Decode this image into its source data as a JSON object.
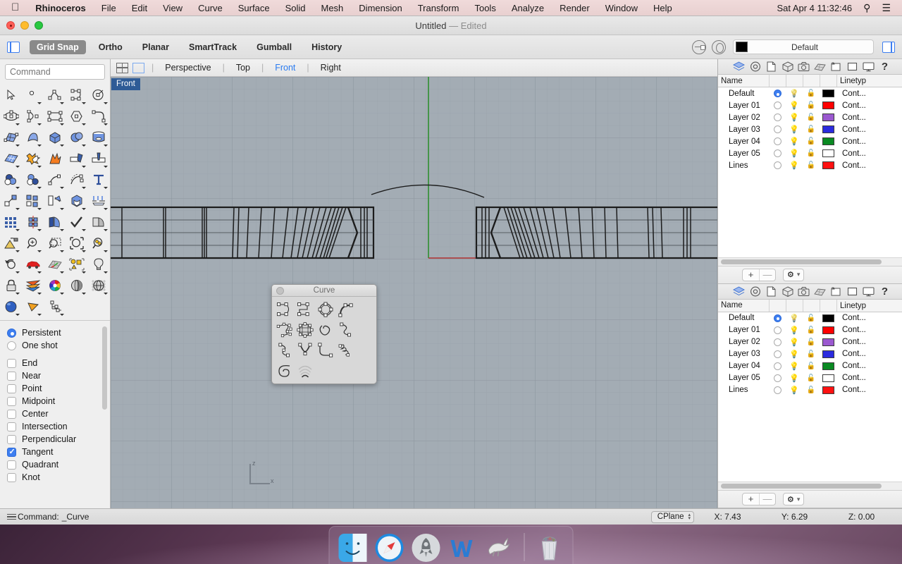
{
  "menubar": {
    "apple_icon": "apple-logo-icon",
    "items": [
      "Rhinoceros",
      "File",
      "Edit",
      "View",
      "Curve",
      "Surface",
      "Solid",
      "Mesh",
      "Dimension",
      "Transform",
      "Tools",
      "Analyze",
      "Render",
      "Window",
      "Help"
    ],
    "clock": "Sat Apr 4  11:32:46",
    "search_icon": "search-icon",
    "notification_icon": "list-icon"
  },
  "window": {
    "title": "Untitled",
    "edited_suffix": "— Edited"
  },
  "toolbar": {
    "toggles": [
      {
        "label": "Grid Snap",
        "active": true
      },
      {
        "label": "Ortho",
        "active": false
      },
      {
        "label": "Planar",
        "active": false
      },
      {
        "label": "SmartTrack",
        "active": false
      },
      {
        "label": "Gumball",
        "active": false
      },
      {
        "label": "History",
        "active": false
      }
    ],
    "layer_swatch_color": "#000000",
    "layer_name": "Default"
  },
  "command": {
    "placeholder": "Command"
  },
  "viewport_tabs": {
    "items": [
      "Perspective",
      "Top",
      "Front",
      "Right"
    ],
    "active": "Front"
  },
  "viewport": {
    "label": "Front",
    "axis_z": "z",
    "axis_x": "x",
    "background_color": "#a3acb4",
    "grid_color": "#8f99a3"
  },
  "curve_palette": {
    "title": "Curve",
    "tools": [
      "control-point-curve-icon",
      "interpolate-curve-icon",
      "curve-through-points-icon",
      "curve-tangent-icon",
      "sketch-curve-icon",
      "curve-network-icon",
      "curve-loop-icon",
      "curve-blend-icon",
      "curve-blend-adjust-icon",
      "parabola-icon",
      "curve-fillet-icon",
      "helix-icon",
      "spiral-icon",
      "arc-array-icon"
    ]
  },
  "osnap": {
    "modes": [
      {
        "label": "Persistent",
        "type": "radio",
        "checked": true
      },
      {
        "label": "One shot",
        "type": "radio",
        "checked": false
      }
    ],
    "snaps": [
      {
        "label": "End",
        "checked": false
      },
      {
        "label": "Near",
        "checked": false
      },
      {
        "label": "Point",
        "checked": false
      },
      {
        "label": "Midpoint",
        "checked": false
      },
      {
        "label": "Center",
        "checked": false
      },
      {
        "label": "Intersection",
        "checked": false
      },
      {
        "label": "Perpendicular",
        "checked": false
      },
      {
        "label": "Tangent",
        "checked": true
      },
      {
        "label": "Quadrant",
        "checked": false
      },
      {
        "label": "Knot",
        "checked": false
      }
    ]
  },
  "layers_panel": {
    "tabs": [
      "layers-icon",
      "object-properties-icon",
      "document-icon",
      "object-icon",
      "camera-icon",
      "render-mesh-icon",
      "display-icon",
      "named-views-icon",
      "monitor-icon",
      "help-icon"
    ],
    "columns": {
      "name": "Name",
      "linetype": "Linetyp"
    },
    "rows": [
      {
        "name": "Default",
        "current": true,
        "color": "#000000",
        "linetype": "Cont..."
      },
      {
        "name": "Layer 01",
        "current": false,
        "color": "#ff0000",
        "linetype": "Cont..."
      },
      {
        "name": "Layer 02",
        "current": false,
        "color": "#9b59d0",
        "linetype": "Cont..."
      },
      {
        "name": "Layer 03",
        "current": false,
        "color": "#2b2bdf",
        "linetype": "Cont..."
      },
      {
        "name": "Layer 04",
        "current": false,
        "color": "#0a8a22",
        "linetype": "Cont..."
      },
      {
        "name": "Layer 05",
        "current": false,
        "color": "#ffffff",
        "linetype": "Cont..."
      },
      {
        "name": "Lines",
        "current": false,
        "color": "#ff1111",
        "linetype": "Cont..."
      }
    ],
    "controls": {
      "add": "+",
      "remove": "—",
      "gear": "gear-icon",
      "chevron": "chevron-down-icon"
    }
  },
  "statusbar": {
    "menu_icon": "hamburger-icon",
    "command_label": "Command:",
    "command_value": "_Curve",
    "cplane_label": "CPlane",
    "x": "X: 7.43",
    "y": "Y: 6.29",
    "z": "Z: 0.00"
  },
  "dock": {
    "items": [
      "finder-icon",
      "safari-icon",
      "launchpad-icon",
      "word-icon",
      "rhinoceros-icon"
    ],
    "trash": "trash-icon"
  }
}
